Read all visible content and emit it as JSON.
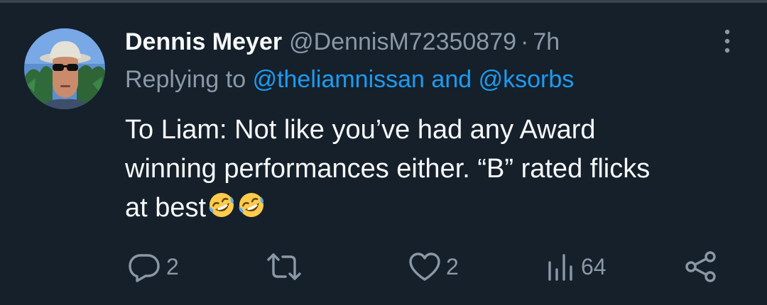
{
  "tweet": {
    "author": {
      "display_name": "Dennis Meyer",
      "handle": "@DennisM72350879",
      "separator": "·",
      "time": "7h"
    },
    "replying_to": {
      "prefix": "Replying to",
      "mention_1": "@theliamnissan",
      "conjunction": "and",
      "mention_2": "@ksorbs"
    },
    "text_lines": [
      "To Liam: Not like you’ve had any Award",
      "winning performances either. “B” rated flicks",
      "at best"
    ],
    "emoji": [
      "rolling-on-floor-laughing",
      "rolling-on-floor-laughing"
    ],
    "actions": {
      "reply_count": "2",
      "like_count": "2",
      "view_count": "64"
    }
  },
  "colors": {
    "background": "#15202b",
    "text": "#f7f9f9",
    "secondary": "#8b98a5",
    "link": "#1d9bf0"
  },
  "icons": [
    "more-icon",
    "reply-icon",
    "retweet-icon",
    "like-icon",
    "views-icon",
    "share-icon"
  ]
}
